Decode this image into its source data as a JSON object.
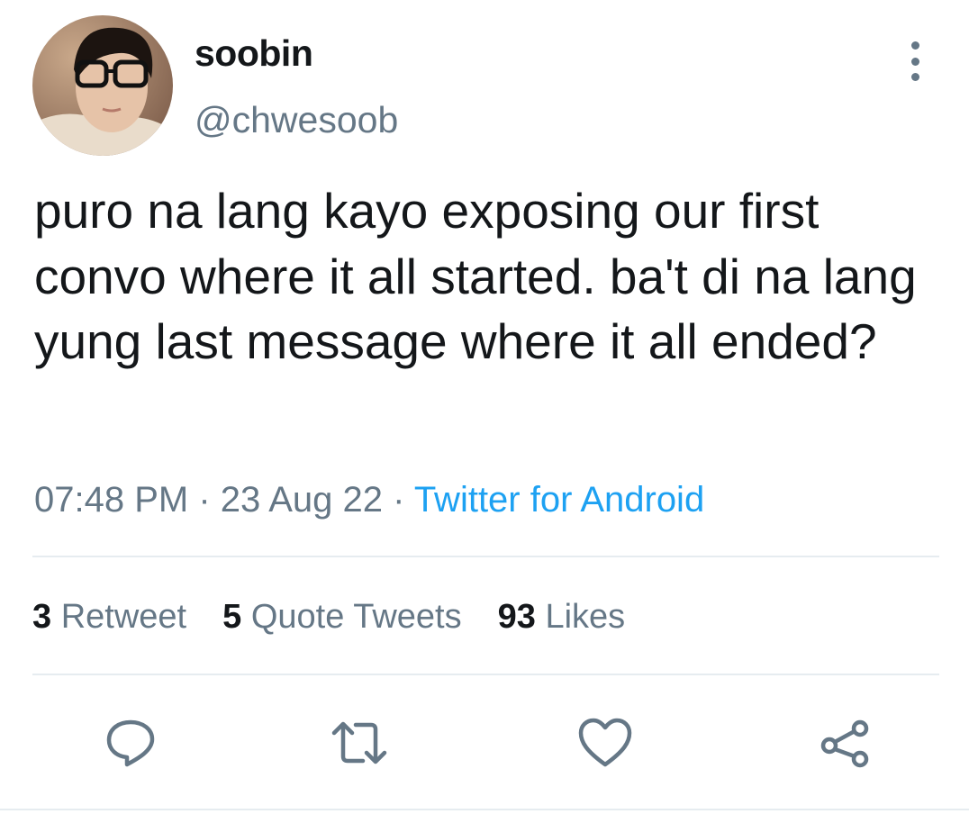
{
  "user": {
    "display_name": "soobin",
    "handle": "@chwesoob"
  },
  "tweet": {
    "text": "puro na lang kayo exposing our first convo where it all started. ba't di na lang yung last message where it all ended?",
    "time": "07:48 PM",
    "separator": "·",
    "date": "23 Aug 22",
    "source": "Twitter for Android"
  },
  "stats": {
    "retweets_count": "3",
    "retweets_label": "Retweet",
    "quotes_count": "5",
    "quotes_label": "Quote Tweets",
    "likes_count": "93",
    "likes_label": "Likes"
  },
  "actions": {
    "reply_icon": "reply-icon",
    "retweet_icon": "retweet-icon",
    "like_icon": "heart-icon",
    "share_icon": "share-icon"
  },
  "colors": {
    "text": "#14171a",
    "secondary": "#657786",
    "link": "#1da1f2",
    "divider": "#e6ecf0"
  }
}
